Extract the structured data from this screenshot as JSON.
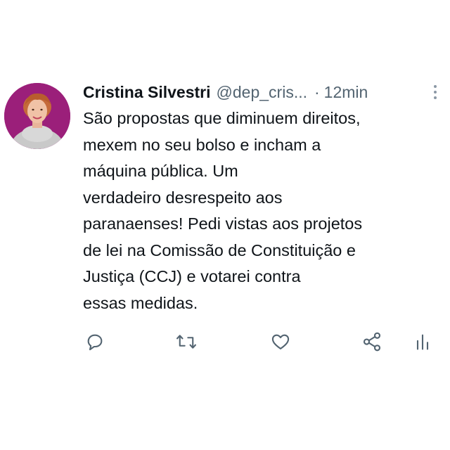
{
  "tweet": {
    "author_name": "Cristina Silvestri",
    "author_handle": "@dep_cris...",
    "separator": "·",
    "time": "12min",
    "text_lines": [
      "São propostas que diminuem direitos,",
      "mexem no seu bolso e incham a",
      "máquina pública. Um",
      "verdadeiro desrespeito aos",
      "paranaenses! Pedi vistas aos projetos",
      "de lei na Comissão de Constituição e",
      "Justiça (CCJ) e votarei contra",
      "essas medidas."
    ]
  },
  "icons": {
    "more": "more-vertical-icon",
    "reply": "reply-icon",
    "retweet": "retweet-icon",
    "like": "heart-icon",
    "share": "share-icon",
    "analytics": "analytics-icon"
  },
  "colors": {
    "text": "#0f1419",
    "secondary": "#536471",
    "avatar_bg": "#9b1f7a"
  }
}
